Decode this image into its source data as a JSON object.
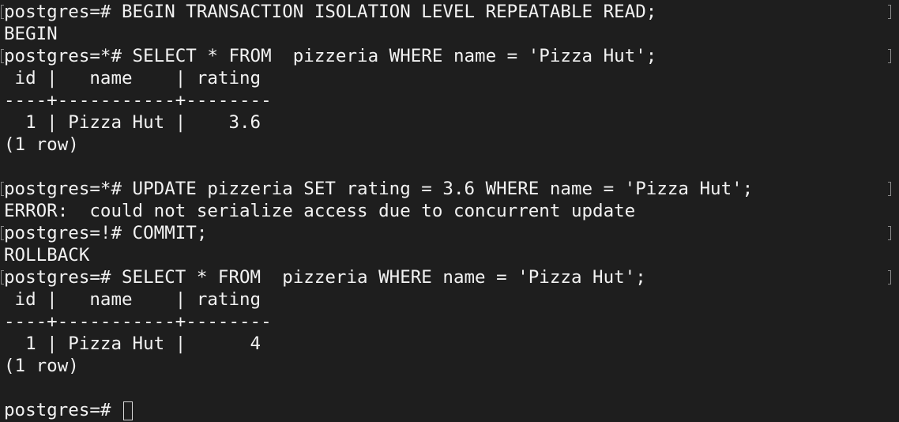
{
  "terminal": {
    "lines": [
      "postgres=# BEGIN TRANSACTION ISOLATION LEVEL REPEATABLE READ;",
      "BEGIN",
      "postgres=*# SELECT * FROM  pizzeria WHERE name = 'Pizza Hut';",
      " id |   name    | rating",
      "----+-----------+--------",
      "  1 | Pizza Hut |    3.6",
      "(1 row)",
      "",
      "postgres=*# UPDATE pizzeria SET rating = 3.6 WHERE name = 'Pizza Hut';",
      "ERROR:  could not serialize access due to concurrent update",
      "postgres=!# COMMIT;",
      "ROLLBACK",
      "postgres=# SELECT * FROM  pizzeria WHERE name = 'Pizza Hut';",
      " id |   name    | rating",
      "----+-----------+--------",
      "  1 | Pizza Hut |      4",
      "(1 row)",
      "",
      "postgres=# "
    ],
    "cursor_icon": "block-cursor-icon",
    "colors": {
      "background": "#1e1e1e",
      "foreground": "#f2f2f2",
      "marks": "#8a8a8a"
    }
  }
}
